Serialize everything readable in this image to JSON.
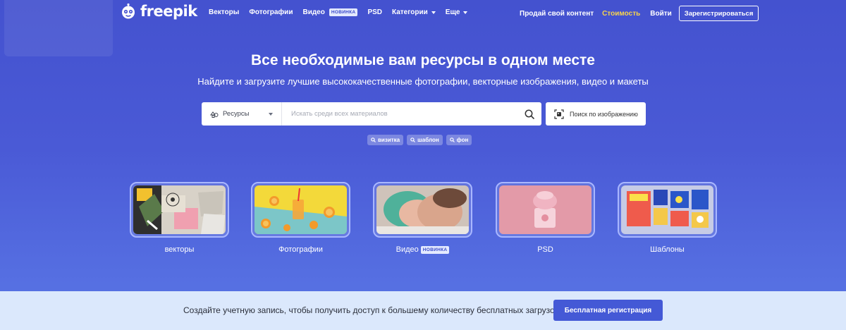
{
  "brand": {
    "name": "freepik"
  },
  "nav": {
    "items": [
      {
        "label": "Векторы"
      },
      {
        "label": "Фотографии"
      },
      {
        "label": "Видео",
        "badge": "НОВИНКА"
      },
      {
        "label": "PSD"
      },
      {
        "label": "Категории",
        "has_dropdown": true
      },
      {
        "label": "Еще",
        "has_dropdown": true
      }
    ],
    "sell_label": "Продай свой контент",
    "pricing_label": "Стоимость",
    "login_label": "Войти",
    "register_label": "Зарегистрироваться"
  },
  "hero": {
    "title": "Все необходимые вам ресурсы в одном месте",
    "subtitle": "Найдите и загрузите лучшие высококачественные фотографии, векторные изображения, видео и макеты"
  },
  "search": {
    "resource_select": "Ресурсы",
    "placeholder": "Искать среди всех материалов",
    "image_search_label": "Поиск по изображению"
  },
  "tags": [
    "визитка",
    "шаблон",
    "фон"
  ],
  "categories": [
    {
      "label": "векторы"
    },
    {
      "label": "Фотографии"
    },
    {
      "label": "Видео",
      "badge": "НОВИНКА"
    },
    {
      "label": "PSD"
    },
    {
      "label": "Шаблоны"
    }
  ],
  "banner": {
    "text": "Создайте учетную запись, чтобы получить доступ к большему количеству бесплатных загрузок",
    "button_label": "Бесплатная регистрация"
  },
  "colors": {
    "background_top": "#4452cf",
    "background_bottom": "#5a77e6",
    "pricing": "#f7d44c",
    "banner_bg": "#dbe8fc",
    "banner_button": "#4459d6"
  }
}
